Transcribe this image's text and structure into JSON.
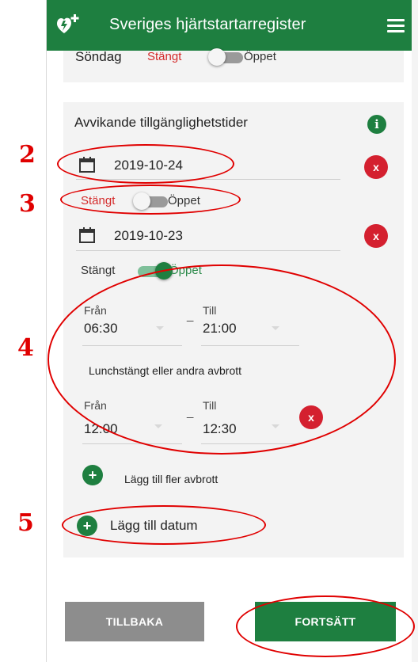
{
  "header": {
    "title": "Sveriges hjärtstartarregister"
  },
  "sunday": {
    "day": "Söndag",
    "closed": "Stängt",
    "open": "Öppet"
  },
  "deviating": {
    "title": "Avvikande tillgänglighetstider",
    "info_icon": "i",
    "date1": {
      "value": "2019-10-24",
      "closed": "Stängt",
      "open": "Öppet",
      "remove": "x"
    },
    "date2": {
      "value": "2019-10-23",
      "closed": "Stängt",
      "open": "Öppet",
      "remove": "x",
      "from_label": "Från",
      "from_value": "06:30",
      "to_label": "Till",
      "to_value": "21:00",
      "separator": "_",
      "break_title": "Lunchstängt eller andra avbrott",
      "break": {
        "from_label": "Från",
        "from_value": "12:00",
        "to_label": "Till",
        "to_value": "12:30",
        "separator": "_",
        "remove": "x"
      },
      "add_break_icon": "+",
      "add_break_label": "Lägg till fler avbrott"
    },
    "add_date_icon": "+",
    "add_date_label": "Lägg till datum"
  },
  "buttons": {
    "back": "TILLBAKA",
    "next": "FORTSÄTT"
  },
  "annotations": [
    "2",
    "3",
    "4",
    "5"
  ],
  "colors": {
    "brand_green": "#1e7f40",
    "danger_red": "#d4202f",
    "annotation_red": "#e00000"
  }
}
